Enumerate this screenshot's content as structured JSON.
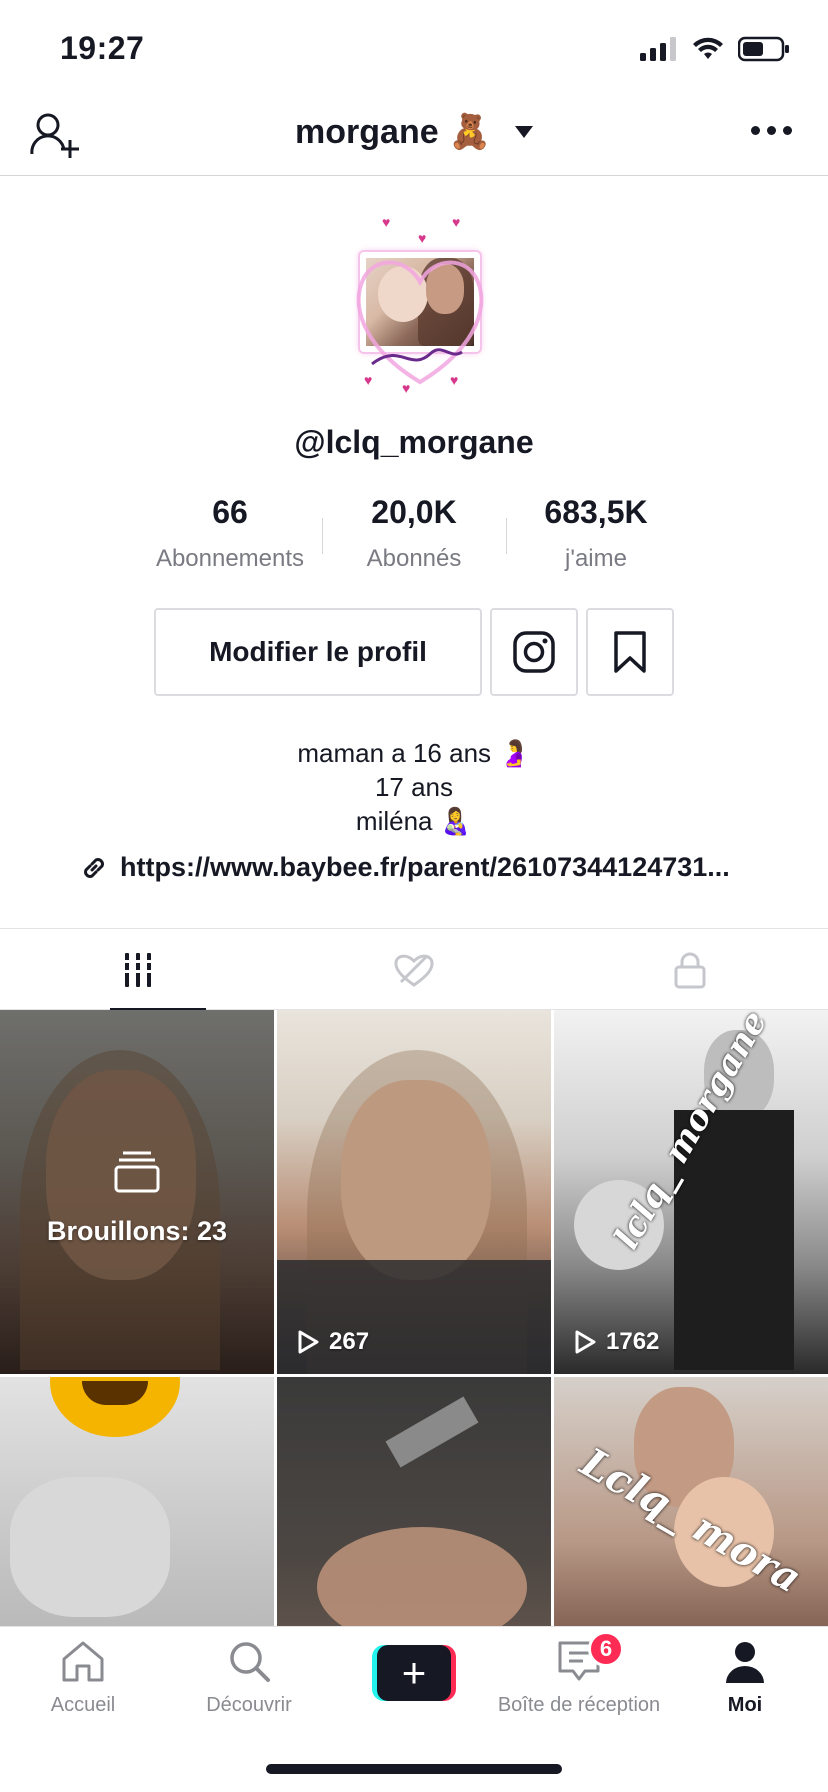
{
  "status_bar": {
    "time": "19:27"
  },
  "header": {
    "name": "morgane",
    "emoji": "🧸"
  },
  "profile": {
    "handle": "@lclq_morgane",
    "stats": [
      {
        "value": "66",
        "label": "Abonnements"
      },
      {
        "value": "20,0K",
        "label": "Abonnés"
      },
      {
        "value": "683,5K",
        "label": "j'aime"
      }
    ],
    "edit_button": "Modifier le profil",
    "bio": [
      "maman a 16 ans 🤰",
      "17 ans",
      "miléna 👩‍🍼"
    ],
    "link": "https://www.baybee.fr/parent/26107344124731..."
  },
  "videos": [
    {
      "label": "Brouillons: 23",
      "kind": "drafts"
    },
    {
      "views": "267"
    },
    {
      "views": "1762",
      "overlay_text": "lclq_ morgane"
    },
    {
      "views": ""
    },
    {
      "views": ""
    },
    {
      "views": "",
      "overlay_text": "Lclq_ mora"
    }
  ],
  "bottom_nav": {
    "items": [
      {
        "label": "Accueil",
        "icon": "home-icon"
      },
      {
        "label": "Découvrir",
        "icon": "search-icon"
      },
      {
        "label": "",
        "icon": "plus-icon"
      },
      {
        "label": "Boîte de réception",
        "icon": "inbox-icon"
      },
      {
        "label": "Moi",
        "icon": "profile-icon"
      }
    ],
    "inbox_badge": "6"
  },
  "colors": {
    "accent": "#fe2c55",
    "cyan": "#25f4ee",
    "text": "#161823",
    "muted": "#8a8b91"
  }
}
